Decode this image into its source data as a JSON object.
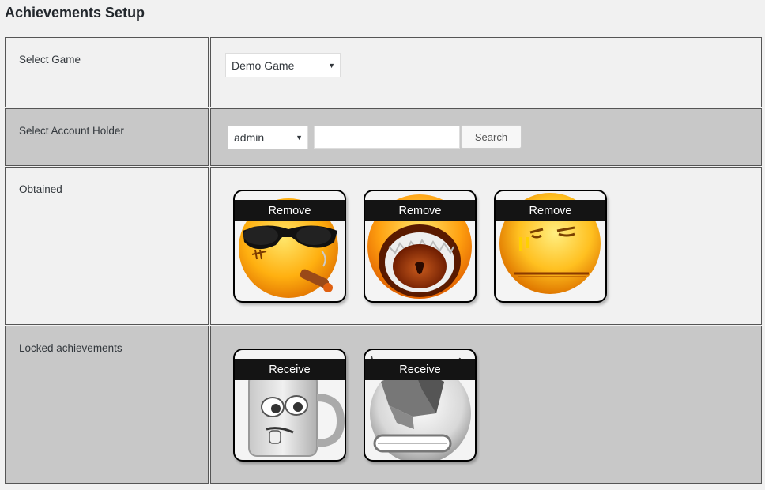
{
  "page": {
    "title": "Achievements Setup"
  },
  "rows": {
    "game": {
      "label": "Select Game",
      "selected": "Demo Game"
    },
    "account": {
      "label": "Select Account Holder",
      "selected": "admin",
      "search_value": "",
      "search_button": "Search"
    },
    "obtained": {
      "label": "Obtained",
      "items": [
        {
          "icon": "cool-smiley-cigar-icon",
          "action": "Remove"
        },
        {
          "icon": "screaming-smiley-icon",
          "action": "Remove"
        },
        {
          "icon": "crying-smiley-icon",
          "action": "Remove"
        }
      ]
    },
    "locked": {
      "label": "Locked achievements",
      "items": [
        {
          "icon": "beer-mug-face-icon",
          "action": "Receive"
        },
        {
          "icon": "smashed-face-icon",
          "action": "Receive"
        }
      ]
    }
  },
  "colors": {
    "light_row": "#f1f1f1",
    "dark_row": "#c8c8c8",
    "badge_bar": "#141414"
  }
}
